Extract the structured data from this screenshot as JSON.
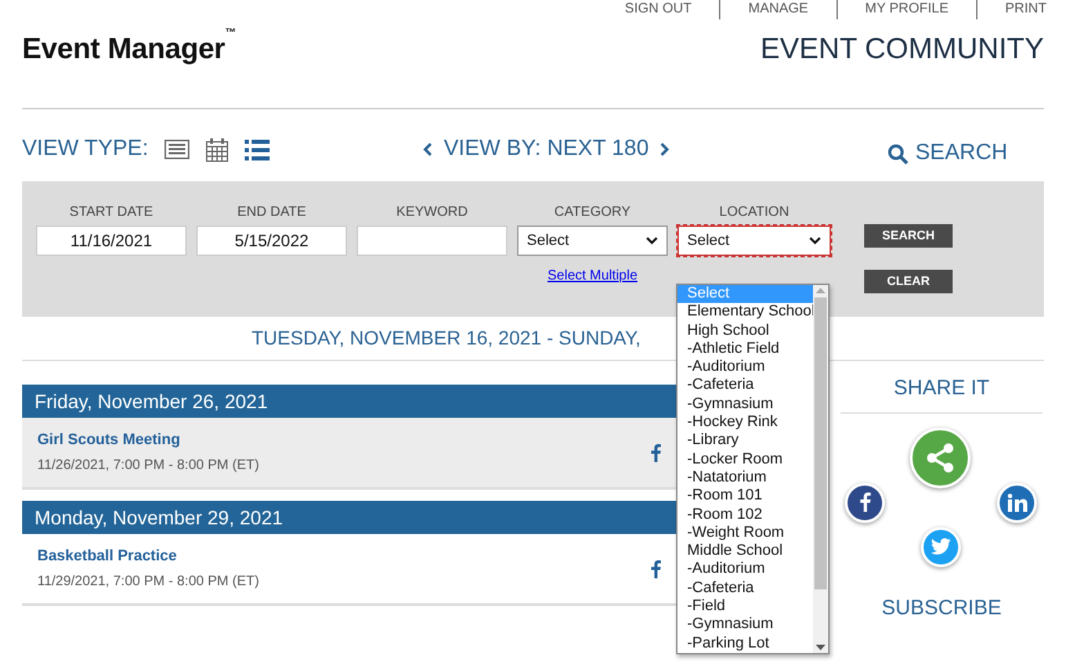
{
  "top_nav": [
    "SIGN OUT",
    "MANAGE",
    "MY PROFILE",
    "PRINT"
  ],
  "logo": {
    "text": "Event Manager",
    "mark": "™"
  },
  "page_title": "EVENT COMMUNITY",
  "view_type": {
    "label": "VIEW TYPE:",
    "views": [
      {
        "kind": "detail",
        "selected": false
      },
      {
        "kind": "calendar",
        "selected": false
      },
      {
        "kind": "list",
        "selected": true
      }
    ]
  },
  "view_by": "VIEW BY: NEXT 180",
  "search_link": "SEARCH",
  "filters": {
    "start_date": {
      "label": "START DATE",
      "value": "11/16/2021"
    },
    "end_date": {
      "label": "END DATE",
      "value": "5/15/2022"
    },
    "keyword": {
      "label": "KEYWORD"
    },
    "category": {
      "label": "CATEGORY",
      "value": "Select",
      "link": "Select Multiple"
    },
    "location": {
      "label": "LOCATION",
      "value": "Select",
      "focused": true,
      "options": [
        {
          "text": "Select",
          "selected": true
        },
        {
          "text": "Elementary School",
          "selected": false
        },
        {
          "text": "High School",
          "selected": false
        },
        {
          "text": "-Athletic Field",
          "selected": false
        },
        {
          "text": "-Auditorium",
          "selected": false
        },
        {
          "text": "-Cafeteria",
          "selected": false
        },
        {
          "text": "-Gymnasium",
          "selected": false
        },
        {
          "text": "-Hockey Rink",
          "selected": false
        },
        {
          "text": "-Library",
          "selected": false
        },
        {
          "text": "-Locker Room",
          "selected": false
        },
        {
          "text": "-Natatorium",
          "selected": false
        },
        {
          "text": "-Room 101",
          "selected": false
        },
        {
          "text": "-Room 102",
          "selected": false
        },
        {
          "text": "-Weight Room",
          "selected": false
        },
        {
          "text": "Middle School",
          "selected": false
        },
        {
          "text": "-Auditorium",
          "selected": false
        },
        {
          "text": "-Cafeteria",
          "selected": false
        },
        {
          "text": "-Field",
          "selected": false
        },
        {
          "text": "-Gymnasium",
          "selected": false
        },
        {
          "text": "-Parking Lot",
          "selected": false
        }
      ]
    },
    "buttons": [
      "SEARCH",
      "CLEAR"
    ]
  },
  "date_range": "TUESDAY, NOVEMBER 16, 2021 - SUNDAY,",
  "days": [
    {
      "date": "Friday, November 26, 2021",
      "events": [
        {
          "title": "Girl Scouts Meeting",
          "time": "11/26/2021, 7:00 PM - 8:00 PM (ET)",
          "shaded": true
        }
      ]
    },
    {
      "date": "Monday, November 29, 2021",
      "events": [
        {
          "title": "Basketball Practice",
          "time": "11/29/2021, 7:00 PM - 8:00 PM (ET)",
          "shaded": false
        }
      ]
    }
  ],
  "share": {
    "title": "SHARE IT"
  },
  "subscribe": {
    "title": "SUBSCRIBE"
  }
}
